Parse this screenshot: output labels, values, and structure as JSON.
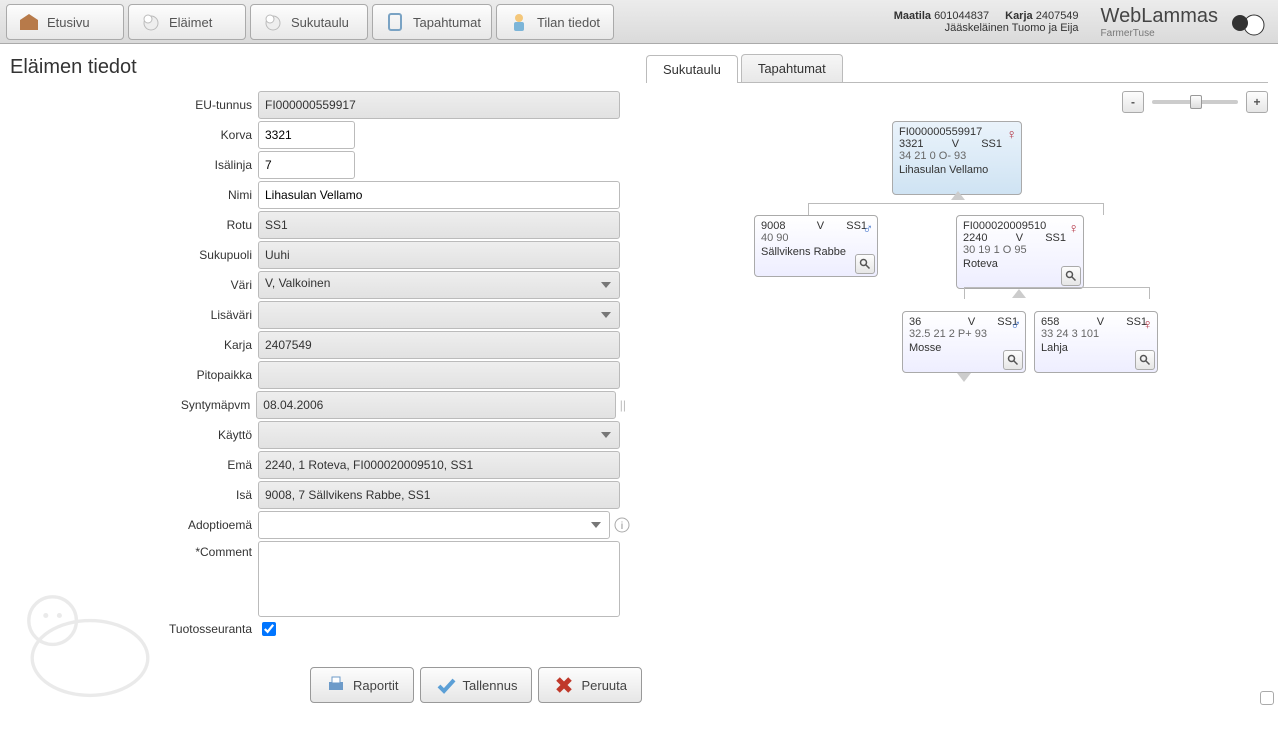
{
  "top": {
    "tabs": [
      "Etusivu",
      "Eläimet",
      "Sukutaulu",
      "Tapahtumat",
      "Tilan tiedot"
    ],
    "maatila_label": "Maatila",
    "maatila_value": "601044837",
    "karja_label": "Karja",
    "karja_value": "2407549",
    "owner": "Jääskeläinen Tuomo ja Eija",
    "brand": "WebLammas",
    "user": "FarmerTuse"
  },
  "page_title": "Eläimen tiedot",
  "form": {
    "labels": {
      "eu": "EU-tunnus",
      "korva": "Korva",
      "isalinja": "Isälinja",
      "nimi": "Nimi",
      "rotu": "Rotu",
      "sukupuoli": "Sukupuoli",
      "vari": "Väri",
      "lisavari": "Lisäväri",
      "karja": "Karja",
      "pitopaikka": "Pitopaikka",
      "syntymapvm": "Syntymäpvm",
      "kaytto": "Käyttö",
      "ema": "Emä",
      "isa": "Isä",
      "adoptioema": "Adoptioemä",
      "comment": "*Comment",
      "tuotosseuranta": "Tuotosseuranta"
    },
    "values": {
      "eu": "FI000000559917",
      "korva": "3321",
      "isalinja": "7",
      "nimi": "Lihasulan Vellamo",
      "rotu": "SS1",
      "sukupuoli": "Uuhi",
      "vari": "V, Valkoinen",
      "lisavari": "",
      "karja": "2407549",
      "pitopaikka": "",
      "syntymapvm": "08.04.2006",
      "kaytto": "",
      "ema": "2240, 1 Roteva, FI000020009510, SS1",
      "isa": "9008, 7 Sällvikens Rabbe, SS1",
      "adoptioema": "",
      "comment": "",
      "tuotosseuranta": true
    }
  },
  "buttons": {
    "raportit": "Raportit",
    "tallennus": "Tallennus",
    "peruuta": "Peruuta"
  },
  "right": {
    "tabs": [
      "Sukutaulu",
      "Tapahtumat"
    ],
    "zoom": {
      "minus": "-",
      "plus": "+"
    },
    "nodes": {
      "root": {
        "eu": "FI000000559917",
        "korva": "3321",
        "col": "V",
        "rotu": "SS1",
        "stats": "34  21   0  O-  93",
        "name": "Lihasulan Vellamo",
        "gender": "♀"
      },
      "sire": {
        "korva": "9008",
        "col": "V",
        "rotu": "SS1",
        "stats": "40              90",
        "name": "Sällvikens Rabbe",
        "gender": "♂"
      },
      "dam": {
        "eu": "FI000020009510",
        "korva": "2240",
        "col": "V",
        "rotu": "SS1",
        "stats": "30  19   1  O   95",
        "name": "Roteva",
        "gender": "♀"
      },
      "mgs": {
        "korva": "36",
        "col": "V",
        "rotu": "SS1",
        "stats": "32.5  21   2  P+  93",
        "name": "Mosse",
        "gender": "♂"
      },
      "mgd": {
        "korva": "658",
        "col": "V",
        "rotu": "SS1",
        "stats": "33  24   3       101",
        "name": "Lahja",
        "gender": "♀"
      }
    }
  }
}
